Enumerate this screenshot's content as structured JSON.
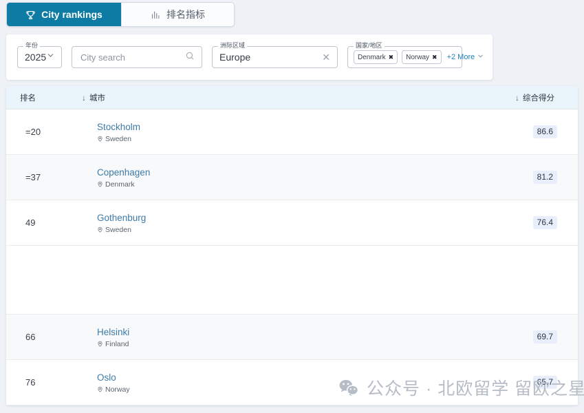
{
  "tabs": [
    {
      "label": "City rankings",
      "icon": "trophy-icon",
      "active": true
    },
    {
      "label": "排名指标",
      "icon": "bar-chart-icon",
      "active": false
    }
  ],
  "filters": {
    "year": {
      "legend": "年份",
      "value": "2025",
      "chevron": "chevron-down-icon"
    },
    "city_search": {
      "placeholder": "City search",
      "value": "",
      "icon": "search-icon"
    },
    "region": {
      "legend": "洲际区域",
      "value": "Europe",
      "clear_icon": "close-icon"
    },
    "country": {
      "legend": "国家/地区",
      "chips": [
        {
          "label": "Denmark",
          "remove": "✖"
        },
        {
          "label": "Norway",
          "remove": "✖"
        }
      ],
      "more_label": "+2 More",
      "more_chevron": "chevron-down-icon"
    }
  },
  "table": {
    "columns": [
      {
        "key": "rank",
        "label": "排名",
        "sorted": false
      },
      {
        "key": "city",
        "label": "城市",
        "sorted": true,
        "sort_icon": "↓"
      },
      {
        "key": "score",
        "label": "综合得分",
        "sorted": true,
        "sort_icon": "↓"
      }
    ],
    "rows": [
      {
        "rank": "=20",
        "city": "Stockholm",
        "country": "Sweden",
        "score": "86.6",
        "style": "plain"
      },
      {
        "rank": "=37",
        "city": "Copenhagen",
        "country": "Denmark",
        "score": "81.2",
        "style": "alt"
      },
      {
        "rank": "49",
        "city": "Gothenburg",
        "country": "Sweden",
        "score": "76.4",
        "style": "plain"
      },
      {
        "rank": "",
        "city": "",
        "country": "",
        "score": "",
        "style": "spacer"
      },
      {
        "rank": "66",
        "city": "Helsinki",
        "country": "Finland",
        "score": "69.7",
        "style": "alt"
      },
      {
        "rank": "76",
        "city": "Oslo",
        "country": "Norway",
        "score": "65.7",
        "style": "plain"
      }
    ]
  },
  "watermark": {
    "icon": "wechat-icon",
    "text": "公众号 · 北欧留学 留欧之星"
  },
  "colors": {
    "page_bg": "#eef1f6",
    "active_tab": "#0d7ba3",
    "table_header_bg": "#eaf4fb",
    "city_link": "#3d7ba8",
    "score_badge_bg": "#e8eefb",
    "more_link": "#1f7fbf"
  }
}
